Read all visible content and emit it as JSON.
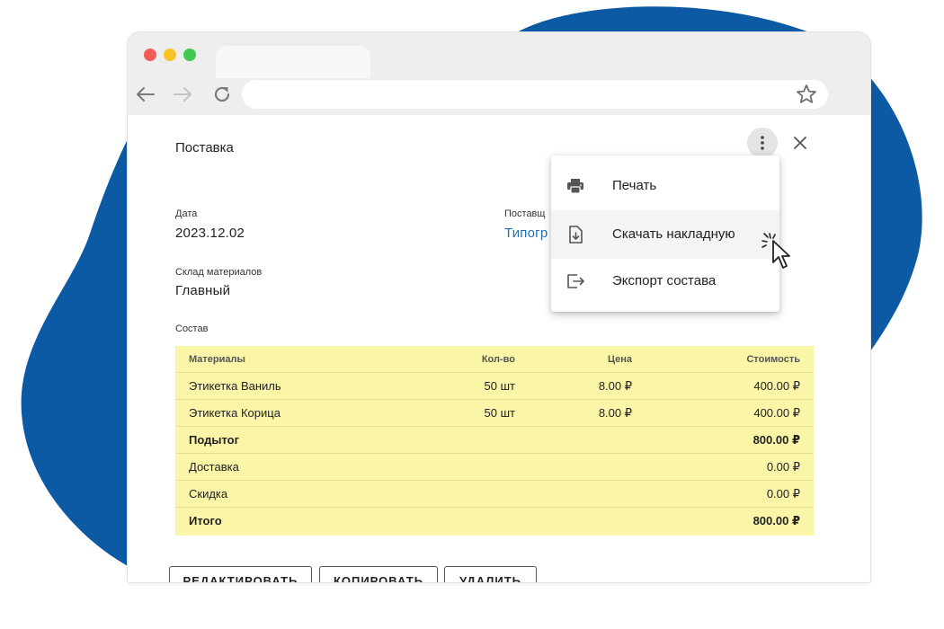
{
  "window": {
    "address": ""
  },
  "dialog": {
    "title": "Поставка",
    "fields": {
      "date_label": "Дата",
      "date_value": "2023.12.02",
      "supplier_label": "Поставщ",
      "supplier_value": "Типогр",
      "warehouse_label": "Склад материалов",
      "warehouse_value": "Главный",
      "composition_label": "Состав"
    }
  },
  "table": {
    "headers": [
      "Материалы",
      "Кол-во",
      "Цена",
      "Стоимость"
    ],
    "rows": [
      {
        "name": "Этикетка Ваниль",
        "qty": "50 шт",
        "price": "8.00 ₽",
        "cost": "400.00 ₽"
      },
      {
        "name": "Этикетка Корица",
        "qty": "50 шт",
        "price": "8.00 ₽",
        "cost": "400.00 ₽"
      }
    ],
    "summary": [
      {
        "label": "Подытог",
        "value": "800.00 ₽"
      },
      {
        "label": "Доставка",
        "value": "0.00 ₽"
      },
      {
        "label": "Скидка",
        "value": "0.00 ₽"
      },
      {
        "label": "Итого",
        "value": "800.00 ₽"
      }
    ]
  },
  "buttons": {
    "edit": "РЕДАКТИРОВАТЬ",
    "copy": "КОПИРОВАТЬ",
    "delete": "УДАЛИТЬ"
  },
  "menu": {
    "items": [
      {
        "label": "Печать",
        "icon": "printer-icon"
      },
      {
        "label": "Скачать накладную",
        "icon": "file-download-icon"
      },
      {
        "label": "Экспорт состава",
        "icon": "export-icon"
      }
    ],
    "hovered_item": "Скачать накладную"
  },
  "colors": {
    "blob": "#0b5aa3",
    "table_bg": "#fbf5a8",
    "link": "#1f6fb6"
  }
}
